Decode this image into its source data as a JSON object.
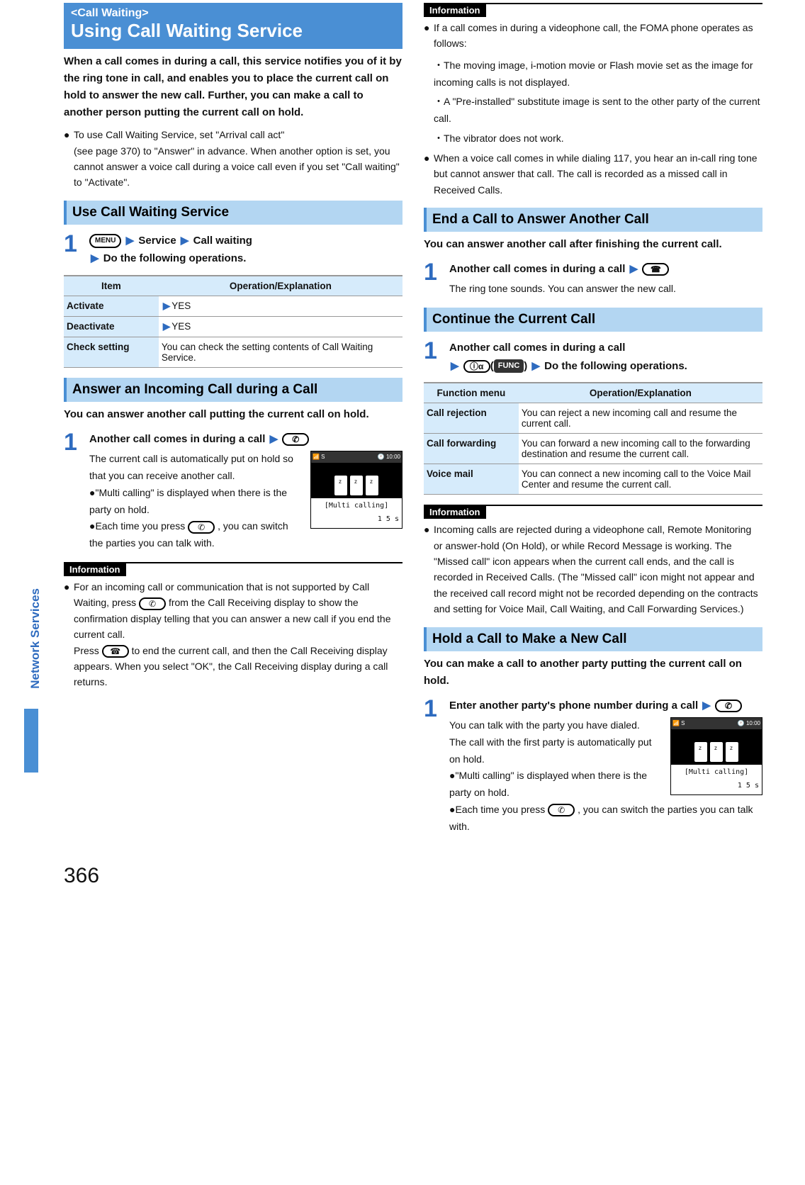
{
  "page_number": "366",
  "side_tab": "Network Services",
  "left": {
    "bluebox_tag": "<Call Waiting>",
    "bluebox_title": "Using Call Waiting Service",
    "lead": "When a call comes in during a call, this service notifies you of it by the ring tone in call, and enables you to place the current call on hold to answer the new call. Further, you can make a call to another person putting the current call on hold.",
    "bullet1_a": "To use Call Waiting Service, set \"Arrival call act\"",
    "bullet1_b": "(see page 370) to \"Answer\" in advance. When another option is set, you cannot answer a voice call during a voice call even if you set \"Call waiting\" to \"Activate\".",
    "sub_use": "Use Call Waiting Service",
    "step1_menu": "MENU",
    "step1_a": "Service",
    "step1_b": "Call waiting",
    "step1_c": "Do the following operations.",
    "table1_h1": "Item",
    "table1_h2": "Operation/Explanation",
    "table1_r1c1": "Activate",
    "table1_r1c2": "YES",
    "table1_r2c1": "Deactivate",
    "table1_r2c2": "YES",
    "table1_r3c1": "Check setting",
    "table1_r3c2": "You can check the setting contents of Call Waiting Service.",
    "sub_answer": "Answer an Incoming Call during a Call",
    "answer_lead": "You can answer another call putting the current call on hold.",
    "answer_step_title": "Another call comes in during a call",
    "answer_plain1": "The current call is automatically put on hold so that you can receive another call.",
    "answer_b1": "\"Multi calling\" is displayed when there is the party on hold.",
    "answer_b2_a": "Each time you press ",
    "answer_b2_b": ", you can switch the parties you can talk with.",
    "info1_title": "Information",
    "info1_body_a": "For an incoming call or communication that is not supported by Call Waiting, press ",
    "info1_body_b": " from the Call Receiving display to show the confirmation display telling that you can answer a new call if you end the current call.",
    "info1_body_c": "Press ",
    "info1_body_d": " to end the current call, and then the Call Receiving display appears. When you select \"OK\", the Call Receiving display during a call returns.",
    "screen_top_left": "📶  S",
    "screen_top_right": "🕐 10:00",
    "screen_caption": "[Multi calling]",
    "screen_timer": "1 5 s"
  },
  "right": {
    "info_top_title": "Information",
    "info_top_1": "If a call comes in during a videophone call, the FOMA phone operates as follows:",
    "info_top_1a": "・The moving image, i-motion movie or Flash movie set as the image for incoming calls is not displayed.",
    "info_top_1b": "・A \"Pre-installed\" substitute image is sent to the other party of the current call.",
    "info_top_1c": "・The vibrator does not work.",
    "info_top_2": "When a voice call comes in while dialing 117, you hear an in-call ring tone but cannot answer that call. The call is recorded as a missed call in Received Calls.",
    "sub_end": "End a Call to Answer Another Call",
    "end_lead": "You can answer another call after finishing the current call.",
    "end_step_title": "Another call comes in during a call",
    "end_step_plain": "The ring tone sounds. You can answer the new call.",
    "sub_continue": "Continue the Current Call",
    "cont_step_title": "Another call comes in during a call",
    "cont_step_func": "FUNC",
    "cont_step_after": "Do the following operations.",
    "table2_h1": "Function menu",
    "table2_h2": "Operation/Explanation",
    "table2_r1c1": "Call rejection",
    "table2_r1c2": "You can reject a new incoming call and resume the current call.",
    "table2_r2c1": "Call forwarding",
    "table2_r2c2": "You can forward a new incoming call to the forwarding destination and resume the current call.",
    "table2_r3c1": "Voice mail",
    "table2_r3c2": "You can connect a new incoming call to the Voice Mail Center and resume the current call.",
    "info2_title": "Information",
    "info2_body": "Incoming calls are rejected during a videophone call, Remote Monitoring or answer-hold (On Hold), or while Record Message is working. The \"Missed call\" icon appears when the current call ends, and the call is recorded in Received Calls. (The \"Missed call\" icon might not appear and the received call record might not be recorded depending on the contracts and setting for Voice Mail, Call Waiting, and Call Forwarding Services.)",
    "sub_hold": "Hold a Call to Make a New Call",
    "hold_lead": "You can make a call to another party putting the current call on hold.",
    "hold_step_title": "Enter another party's phone number during a call",
    "hold_plain1": "You can talk with the party you have dialed.",
    "hold_plain2": "The call with the first party is automatically put on hold.",
    "hold_b1": "\"Multi calling\" is displayed when there is the party on hold.",
    "hold_b2_a": "Each time you press ",
    "hold_b2_b": ", you can switch the parties you can talk with."
  }
}
